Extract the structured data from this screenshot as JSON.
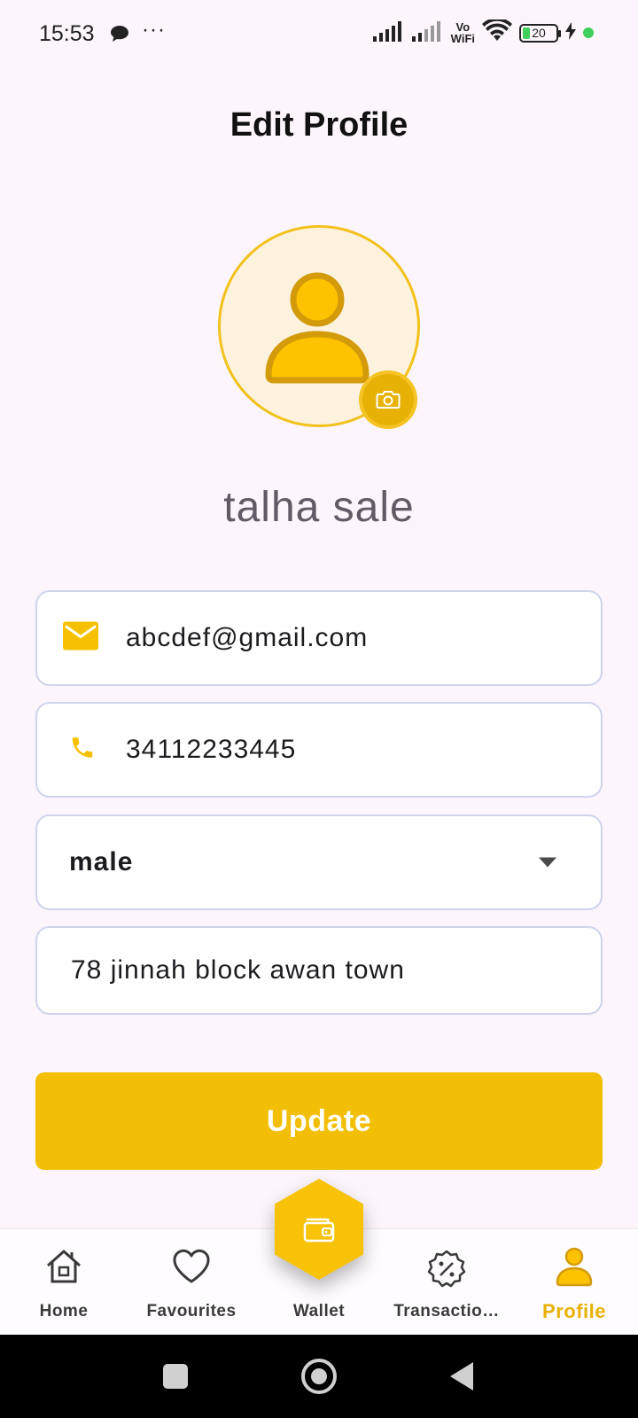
{
  "status_bar": {
    "time": "15:53",
    "dots": "···",
    "vo_wifi_top": "Vo",
    "vo_wifi_bottom": "WiFi",
    "battery_level": "20",
    "icons": [
      "message-icon",
      "signal-icon",
      "signal-icon",
      "wifi-icon",
      "battery-icon",
      "charging-icon"
    ]
  },
  "page": {
    "title": "Edit Profile"
  },
  "profile": {
    "name": "talha sale",
    "avatar_icon": "person-icon",
    "camera_icon": "camera-icon"
  },
  "form": {
    "email": {
      "value": "abcdef@gmail.com",
      "icon": "mail-icon"
    },
    "phone": {
      "value": "34112233445",
      "icon": "phone-icon"
    },
    "gender": {
      "value": "male",
      "icon": "dropdown-arrow-icon"
    },
    "address": {
      "value": "78 jinnah block awan town"
    }
  },
  "update_button": {
    "label": "Update"
  },
  "bottom_nav": {
    "items": [
      {
        "label": "Home",
        "icon": "home-icon"
      },
      {
        "label": "Favourites",
        "icon": "heart-icon"
      },
      {
        "label": "Wallet",
        "icon": "wallet-icon"
      },
      {
        "label": "Transactio…",
        "icon": "discount-badge-icon"
      },
      {
        "label": "Profile",
        "icon": "person-icon",
        "active": true
      }
    ]
  },
  "colors": {
    "accent": "#f2be06",
    "background": "#fcf6fc",
    "field_border": "#cfd4ec",
    "name_text": "#625b66"
  }
}
